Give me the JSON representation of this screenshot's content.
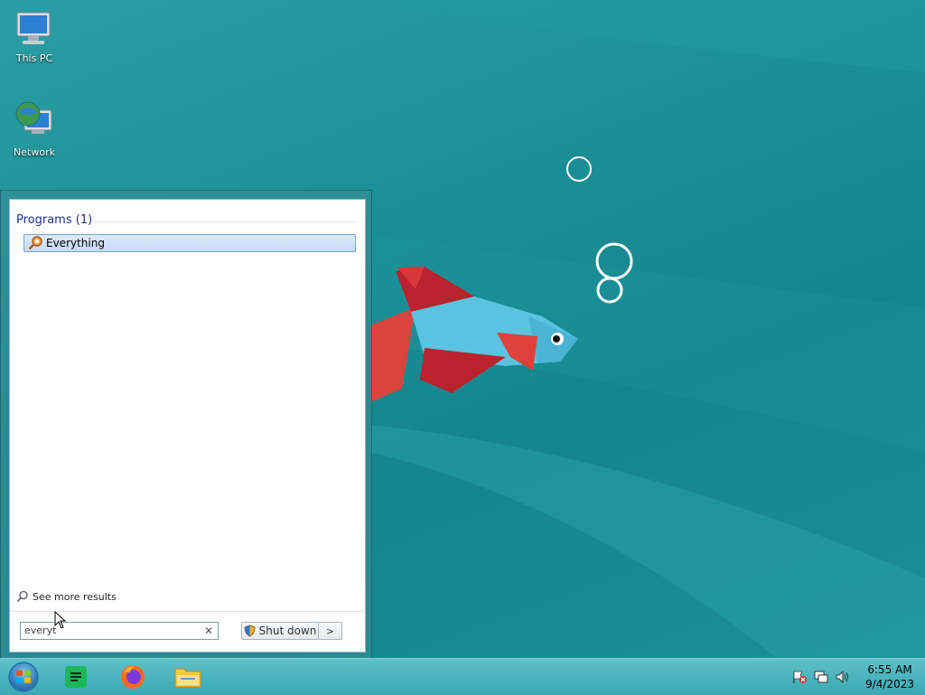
{
  "desktop": {
    "icons": [
      {
        "label": "This PC",
        "icon": "computer-icon"
      },
      {
        "label": "Network",
        "icon": "network-icon"
      }
    ]
  },
  "start_menu": {
    "section_title": "Programs (1)",
    "results": [
      {
        "label": "Everything",
        "icon": "everything-app-icon",
        "selected": true
      }
    ],
    "see_more": "See more results",
    "search": {
      "value": "everyt",
      "clear_icon": "close-icon"
    },
    "shutdown": {
      "label": "Shut down",
      "arrow": ">"
    }
  },
  "taskbar": {
    "start_icon": "windows-start-icon",
    "pinned": [
      {
        "name": "notes-app-icon",
        "color": "#19b85a"
      },
      {
        "name": "firefox-icon",
        "color": "#ff6a1f"
      },
      {
        "name": "file-explorer-icon",
        "color": "#f3c84b"
      }
    ],
    "tray": {
      "icons": [
        "action-center-flag-icon",
        "network-tray-icon",
        "volume-icon"
      ],
      "time": "6:55 AM",
      "date": "9/4/2023"
    }
  },
  "colors": {
    "wallpaper": "#1a8f96",
    "selection": "#c4dcf5",
    "fish_body": "#5bc3e0",
    "fish_fin": "#c8303c"
  }
}
